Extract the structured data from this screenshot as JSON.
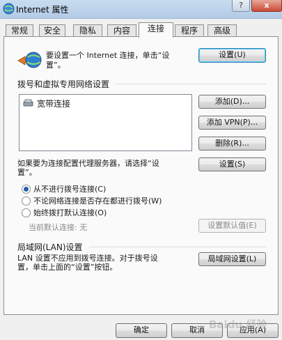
{
  "window": {
    "title": "Internet 属性",
    "help_glyph": "?",
    "close_glyph": "x"
  },
  "tabs": [
    {
      "label": "常规"
    },
    {
      "label": "安全"
    },
    {
      "label": "隐私"
    },
    {
      "label": "内容"
    },
    {
      "label": "连接",
      "active": true
    },
    {
      "label": "程序"
    },
    {
      "label": "高级"
    }
  ],
  "setup": {
    "text_line1": "要设置一个 Internet 连接，单击“设",
    "text_line2": "置”。",
    "button": "设置(U)"
  },
  "dialup": {
    "title": "拨号和虚拟专用网络设置",
    "connections": [
      "宽带连接"
    ],
    "add_button": "添加(D)...",
    "add_vpn_button": "添加 VPN(P)...",
    "remove_button": "删除(R)...",
    "proxy_line1": "如果要为连接配置代理服务器，请选择“设",
    "proxy_line2": "置”。",
    "settings_button": "设置(S)",
    "options": [
      {
        "label": "从不进行拨号连接(C)",
        "checked": true
      },
      {
        "label": "不论网络连接是否存在都进行拨号(W)",
        "checked": false
      },
      {
        "label": "始终拨打默认连接(O)",
        "checked": false
      }
    ],
    "current_default": "当前默认连接: 无",
    "set_default_button": "设置默认值(E)"
  },
  "lan": {
    "title": "局域网(LAN)设置",
    "text_line1": "LAN 设置不应用到拨号连接。对于拨号设",
    "text_line2": "置，单击上面的“设置”按钮。",
    "button": "局域网设置(L)"
  },
  "footer": {
    "ok": "确定",
    "cancel": "取消",
    "apply": "应用(A)"
  },
  "watermark": "Baidu 经验"
}
